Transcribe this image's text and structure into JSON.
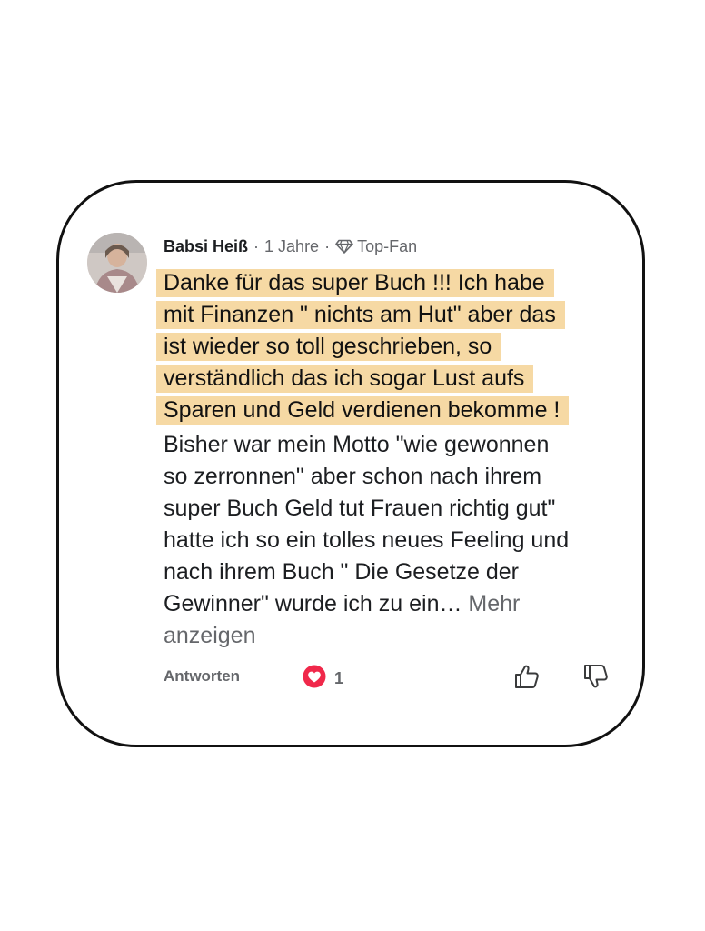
{
  "comment": {
    "author": "Babsi Heiß",
    "time": "1 Jahre",
    "badge": "Top-Fan",
    "separator": "·",
    "highlighted_lines": [
      "Danke für das super Buch !!! Ich habe",
      "mit Finanzen \" nichts am Hut\" aber das",
      "ist wieder so toll geschrieben,  so",
      "verständlich das ich sogar Lust aufs",
      "Sparen und Geld verdienen bekomme !"
    ],
    "body_lines": [
      "Bisher war mein Motto \"wie gewonnen",
      "so zerronnen\" aber schon nach ihrem",
      "super Buch Geld tut Frauen richtig gut\"",
      "hatte ich so ein tolles neues Feeling und",
      "nach ihrem Buch \" Die Gesetze der"
    ],
    "last_line_text": "Gewinner\" wurde ich zu ein…",
    "more_label_part1": "Mehr",
    "more_label_part2": "anzeigen"
  },
  "actions": {
    "reply_label": "Antworten",
    "reaction_count": "1",
    "reaction_icon": "heart-icon",
    "like_icon": "thumbs-up-icon",
    "dislike_icon": "thumbs-down-icon"
  },
  "colors": {
    "highlight": "#f6d9a4",
    "heart": "#f0284a",
    "muted_text": "#65676b",
    "border": "#111111"
  }
}
